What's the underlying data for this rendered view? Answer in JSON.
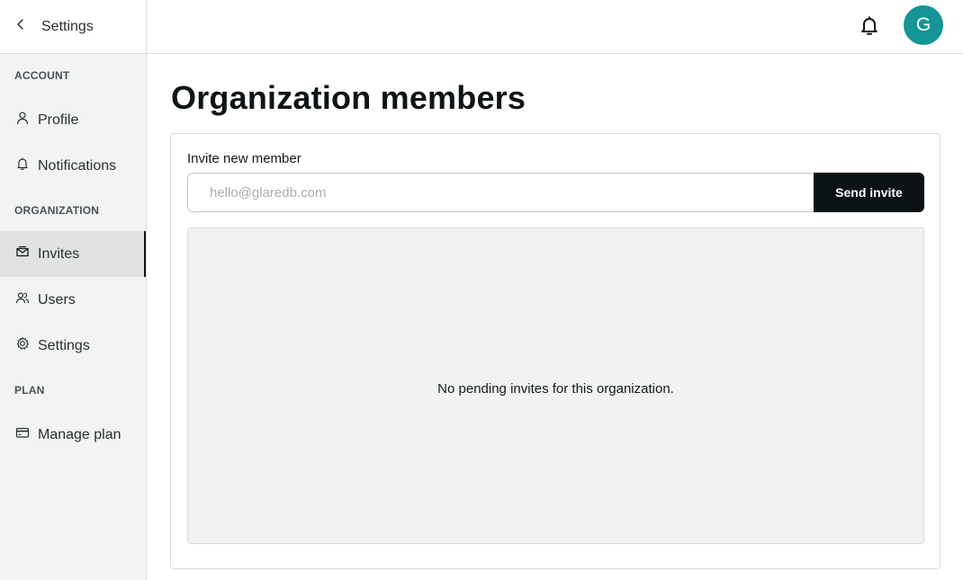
{
  "sidebar": {
    "back_label": "Settings",
    "sections": {
      "account": "ACCOUNT",
      "organization": "ORGANIZATION",
      "plan": "PLAN"
    },
    "items": {
      "profile": "Profile",
      "notifications": "Notifications",
      "invites": "Invites",
      "users": "Users",
      "settings": "Settings",
      "manage_plan": "Manage plan"
    },
    "active_item": "invites"
  },
  "header": {
    "avatar_initial": "G",
    "avatar_color": "#159596"
  },
  "main": {
    "title": "Organization members",
    "invite": {
      "label": "Invite new member",
      "placeholder": "hello@glaredb.com",
      "value": "",
      "button_label": "Send invite"
    },
    "empty_message": "No pending invites for this organization."
  },
  "icons": {
    "back": "chevron-left-icon",
    "profile": "user-icon",
    "notifications": "bell-icon",
    "invites": "envelope-icon",
    "users": "users-icon",
    "settings": "gear-icon",
    "manage_plan": "credit-card-icon",
    "header_bell": "bell-icon"
  }
}
